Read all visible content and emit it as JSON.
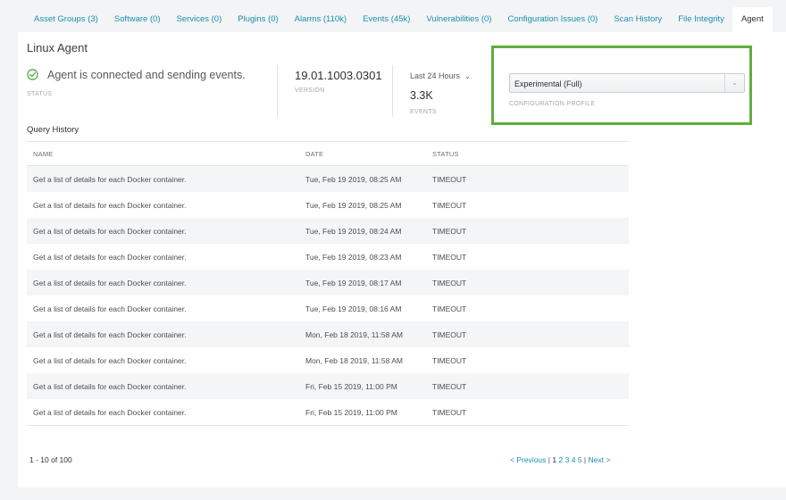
{
  "tabs": [
    {
      "label": "Asset Groups (3)"
    },
    {
      "label": "Software (0)"
    },
    {
      "label": "Services (0)"
    },
    {
      "label": "Plugins (0)"
    },
    {
      "label": "Alarms (110k)"
    },
    {
      "label": "Events (45k)"
    },
    {
      "label": "Vulnerabilities (0)"
    },
    {
      "label": "Configuration Issues (0)"
    },
    {
      "label": "Scan History"
    },
    {
      "label": "File Integrity"
    },
    {
      "label": "Agent"
    }
  ],
  "active_tab": "Agent",
  "agent": {
    "title": "Linux Agent",
    "status_text": "Agent is connected and sending events.",
    "status_label": "STATUS",
    "status_icon": "check-circle-icon",
    "version": "19.01.1003.0301",
    "version_label": "VERSION",
    "range": "Last 24 Hours",
    "events_value": "3.3K",
    "events_label": "EVENTS"
  },
  "profile": {
    "selected": "Experimental (Full)",
    "label": "CONFIGURATION PROFILE"
  },
  "query_history": {
    "title": "Query History",
    "columns": [
      "NAME",
      "DATE",
      "STATUS"
    ],
    "rows": [
      {
        "name": "Get a list of details for each Docker container.",
        "date": "Tue, Feb 19 2019, 08:25 AM",
        "status": "TIMEOUT"
      },
      {
        "name": "Get a list of details for each Docker container.",
        "date": "Tue, Feb 19 2019, 08:25 AM",
        "status": "TIMEOUT"
      },
      {
        "name": "Get a list of details for each Docker container.",
        "date": "Tue, Feb 19 2019, 08:24 AM",
        "status": "TIMEOUT"
      },
      {
        "name": "Get a list of details for each Docker container.",
        "date": "Tue, Feb 19 2019, 08:23 AM",
        "status": "TIMEOUT"
      },
      {
        "name": "Get a list of details for each Docker container.",
        "date": "Tue, Feb 19 2019, 08:17 AM",
        "status": "TIMEOUT"
      },
      {
        "name": "Get a list of details for each Docker container.",
        "date": "Tue, Feb 19 2019, 08:16 AM",
        "status": "TIMEOUT"
      },
      {
        "name": "Get a list of details for each Docker container.",
        "date": "Mon, Feb 18 2019, 11:58 AM",
        "status": "TIMEOUT"
      },
      {
        "name": "Get a list of details for each Docker container.",
        "date": "Mon, Feb 18 2019, 11:58 AM",
        "status": "TIMEOUT"
      },
      {
        "name": "Get a list of details for each Docker container.",
        "date": "Fri, Feb 15 2019, 11:00 PM",
        "status": "TIMEOUT"
      },
      {
        "name": "Get a list of details for each Docker container.",
        "date": "Fri, Feb 15 2019, 11:00 PM",
        "status": "TIMEOUT"
      }
    ],
    "count_text": "1 - 10 of 100"
  },
  "pagination": {
    "previous": "< Previous",
    "separator": "|",
    "pages": [
      "1",
      "2",
      "3",
      "4",
      "5"
    ],
    "current": "1",
    "next": "Next >"
  },
  "colors": {
    "link": "#1a8fb0",
    "success": "#4caf50",
    "highlight_border": "#5fae3e"
  }
}
